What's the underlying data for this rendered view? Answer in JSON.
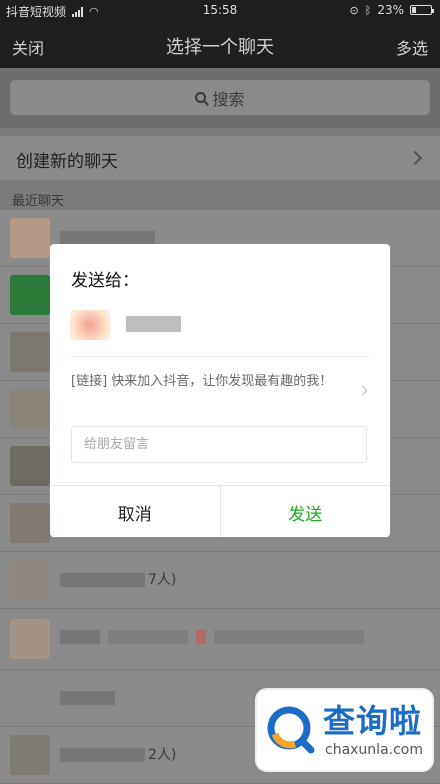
{
  "status_bar": {
    "carrier": "抖音短视频",
    "time": "15:58",
    "battery": "23%",
    "battery_level": 0.23
  },
  "nav": {
    "close": "关闭",
    "title": "选择一个聊天",
    "multi_select": "多选"
  },
  "search": {
    "placeholder": "搜索"
  },
  "new_chat": {
    "label": "创建新的聊天"
  },
  "recent": {
    "header": "最近聊天",
    "row_suffix_1": "7人)",
    "row_suffix_2": "2人)"
  },
  "dialog": {
    "title": "发送给：",
    "link_text": "[链接] 快来加入抖音，让你发现最有趣的我！",
    "message_placeholder": "给朋友留言",
    "cancel": "取消",
    "send": "发送"
  },
  "watermark": {
    "title": "查询啦",
    "domain": "chaxunla.com"
  },
  "colors": {
    "send_green": "#1aad19",
    "watermark_blue": "#1b6cc7",
    "nav_bg": "#1f1f1f"
  }
}
